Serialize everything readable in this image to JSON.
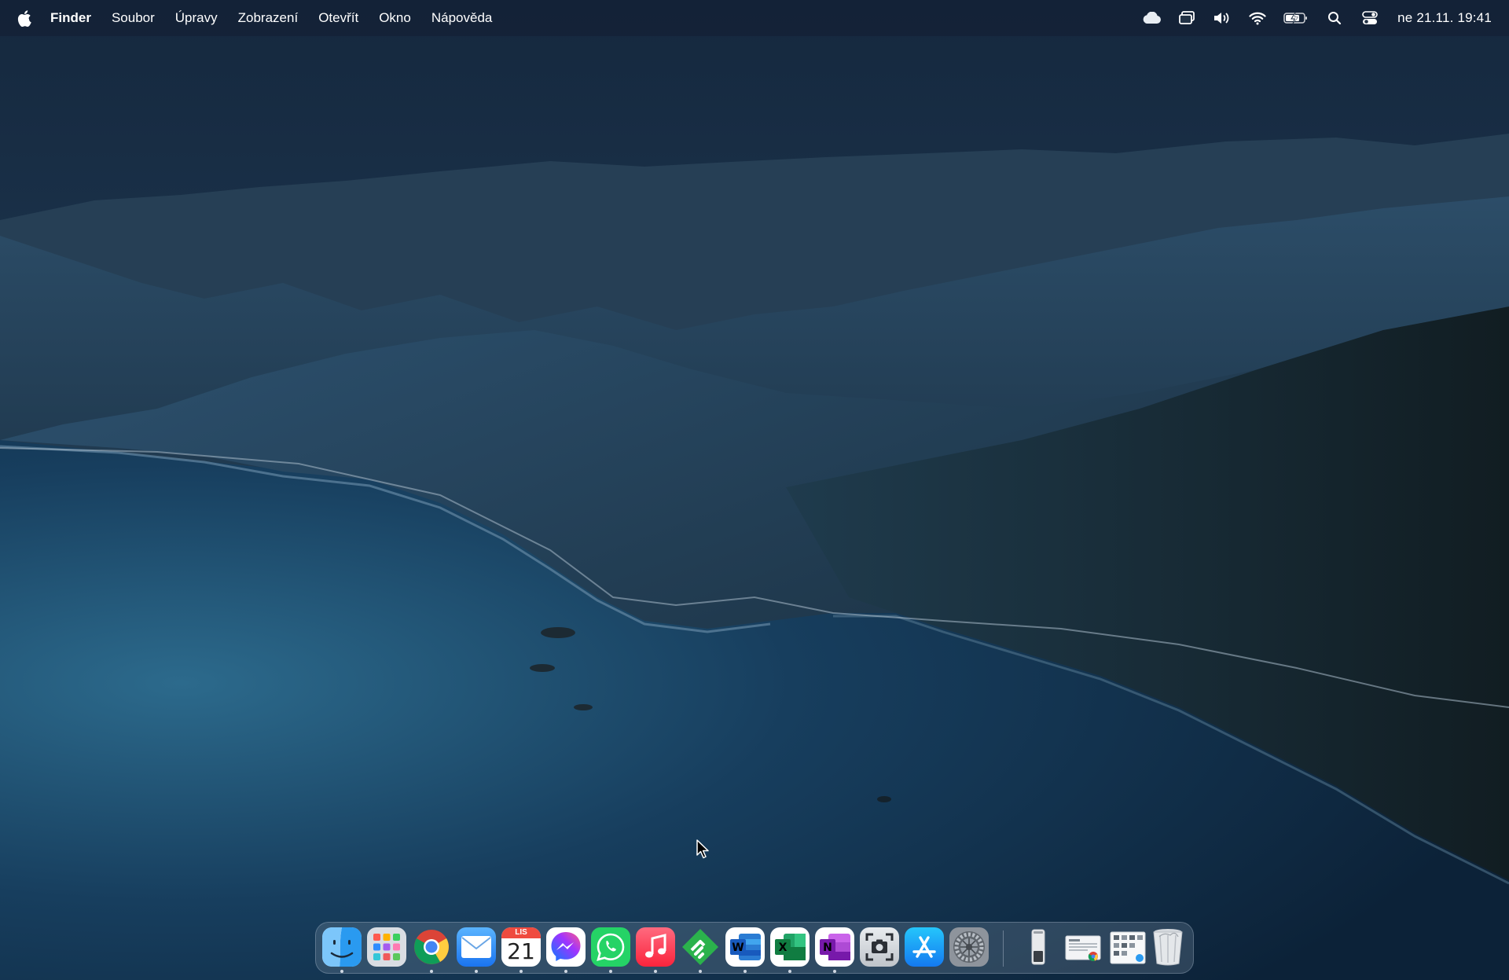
{
  "menubar": {
    "app_name": "Finder",
    "items": [
      "Soubor",
      "Úpravy",
      "Zobrazení",
      "Otevřít",
      "Okno",
      "Nápověda"
    ],
    "clock": "ne 21.11.  19:41"
  },
  "status_icons": [
    "cloud-icon",
    "display-mirroring-icon",
    "volume-icon",
    "wifi-icon",
    "battery-charging-icon",
    "spotlight-search-icon",
    "control-center-icon"
  ],
  "dock": {
    "apps": [
      {
        "name": "finder-icon",
        "running": true
      },
      {
        "name": "launchpad-icon",
        "running": false
      },
      {
        "name": "chrome-icon",
        "running": true
      },
      {
        "name": "mail-icon",
        "running": true
      },
      {
        "name": "calendar-icon",
        "running": true
      },
      {
        "name": "messenger-icon",
        "running": true
      },
      {
        "name": "whatsapp-icon",
        "running": true
      },
      {
        "name": "music-icon",
        "running": true
      },
      {
        "name": "feedly-icon",
        "running": true
      },
      {
        "name": "word-icon",
        "running": true
      },
      {
        "name": "excel-icon",
        "running": true
      },
      {
        "name": "onenote-icon",
        "running": true
      },
      {
        "name": "screenshot-icon",
        "running": false
      },
      {
        "name": "app-store-icon",
        "running": false
      },
      {
        "name": "system-preferences-icon",
        "running": false
      }
    ],
    "calendar_month": "LIS",
    "calendar_day": "21",
    "right_items": [
      "downloads-stack-icon",
      "documents-stack-icon",
      "desktop-stack-icon",
      "trash-icon"
    ]
  },
  "colors": {
    "sky_top": "#16293f",
    "sea": "#1d4a6e",
    "mountain": "#1b2e3c",
    "accent": "#0a84ff"
  }
}
